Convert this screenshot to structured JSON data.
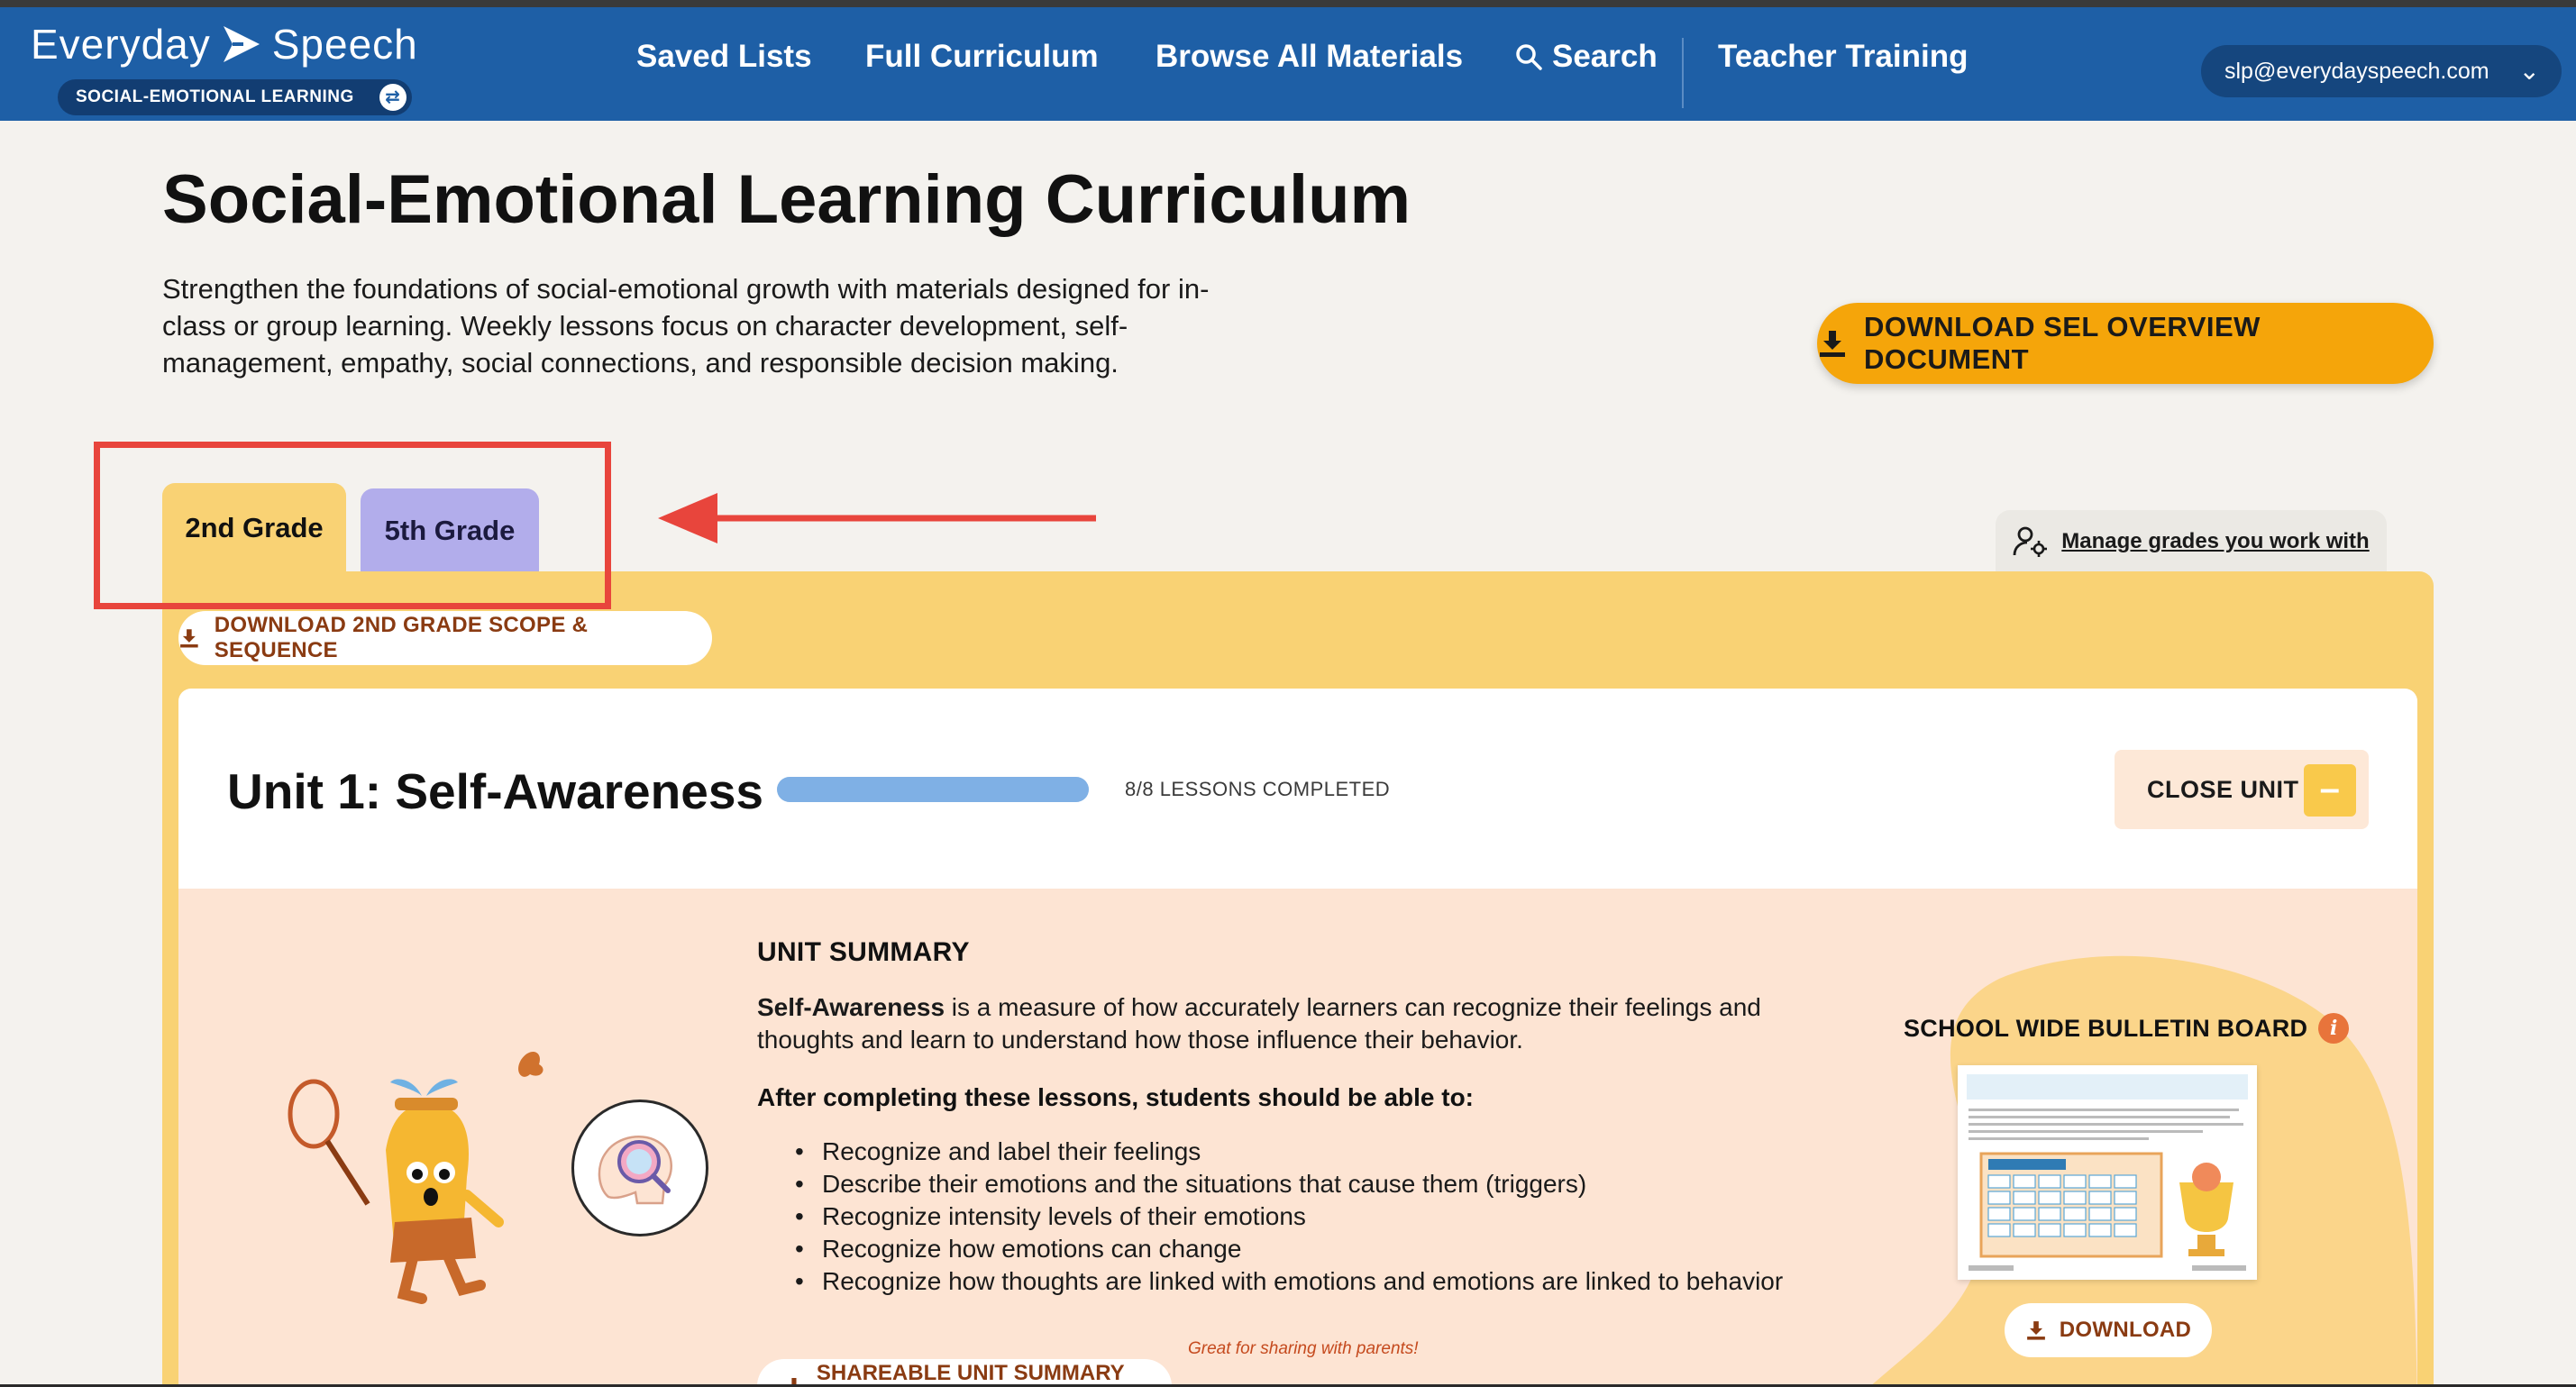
{
  "header": {
    "logo_text_1": "Everyday",
    "logo_text_2": "Speech",
    "badge": "SOCIAL-EMOTIONAL LEARNING",
    "nav": [
      "Saved Lists",
      "Full Curriculum",
      "Browse All Materials",
      "Search",
      "Teacher Training"
    ],
    "account_email": "slp@everydayspeech.com"
  },
  "page": {
    "title": "Social-Emotional Learning Curriculum",
    "description": "Strengthen the foundations of social-emotional growth with materials designed for in-class or group learning. Weekly lessons focus on character development, self-management, empathy, social connections, and responsible decision making.",
    "overview_button": "DOWNLOAD SEL OVERVIEW DOCUMENT"
  },
  "tabs": {
    "grade_2": "2nd Grade",
    "grade_5": "5th Grade",
    "manage": "Manage grades you work with"
  },
  "panel": {
    "scope_button": "DOWNLOAD 2ND GRADE SCOPE & SEQUENCE"
  },
  "unit": {
    "title": "Unit 1: Self-Awareness",
    "progress": 1.0,
    "progress_text": "8/8 LESSONS COMPLETED",
    "close_label": "CLOSE UNIT",
    "close_symbol": "–",
    "summary_head": "UNIT SUMMARY",
    "summary_bold": "Self-Awareness",
    "summary_rest": " is a measure of how accurately learners can recognize their feelings and thoughts and learn to understand how those influence their behavior.",
    "after_head": "After completing these lessons, students should be able to:",
    "goals": [
      "Recognize and label their feelings",
      "Describe their emotions and the situations that cause them (triggers)",
      "Recognize intensity levels of their emotions",
      "Recognize how emotions can change",
      "Recognize how thoughts are linked with emotions and emotions are linked to behavior"
    ],
    "shareable_button": "SHAREABLE UNIT SUMMARY PDF",
    "great_note": "Great for sharing with parents!",
    "bulletin_head": "SCHOOL WIDE BULLETIN BOARD",
    "bulletin_info": "i",
    "download_label": "DOWNLOAD"
  },
  "colors": {
    "header_blue": "#1e5fa6",
    "accent_orange": "#f5a50a",
    "grade2_yellow": "#f9d274",
    "grade5_purple": "#b2adeb",
    "annotation_red": "#e8453c",
    "summary_peach": "#fde4d3"
  }
}
